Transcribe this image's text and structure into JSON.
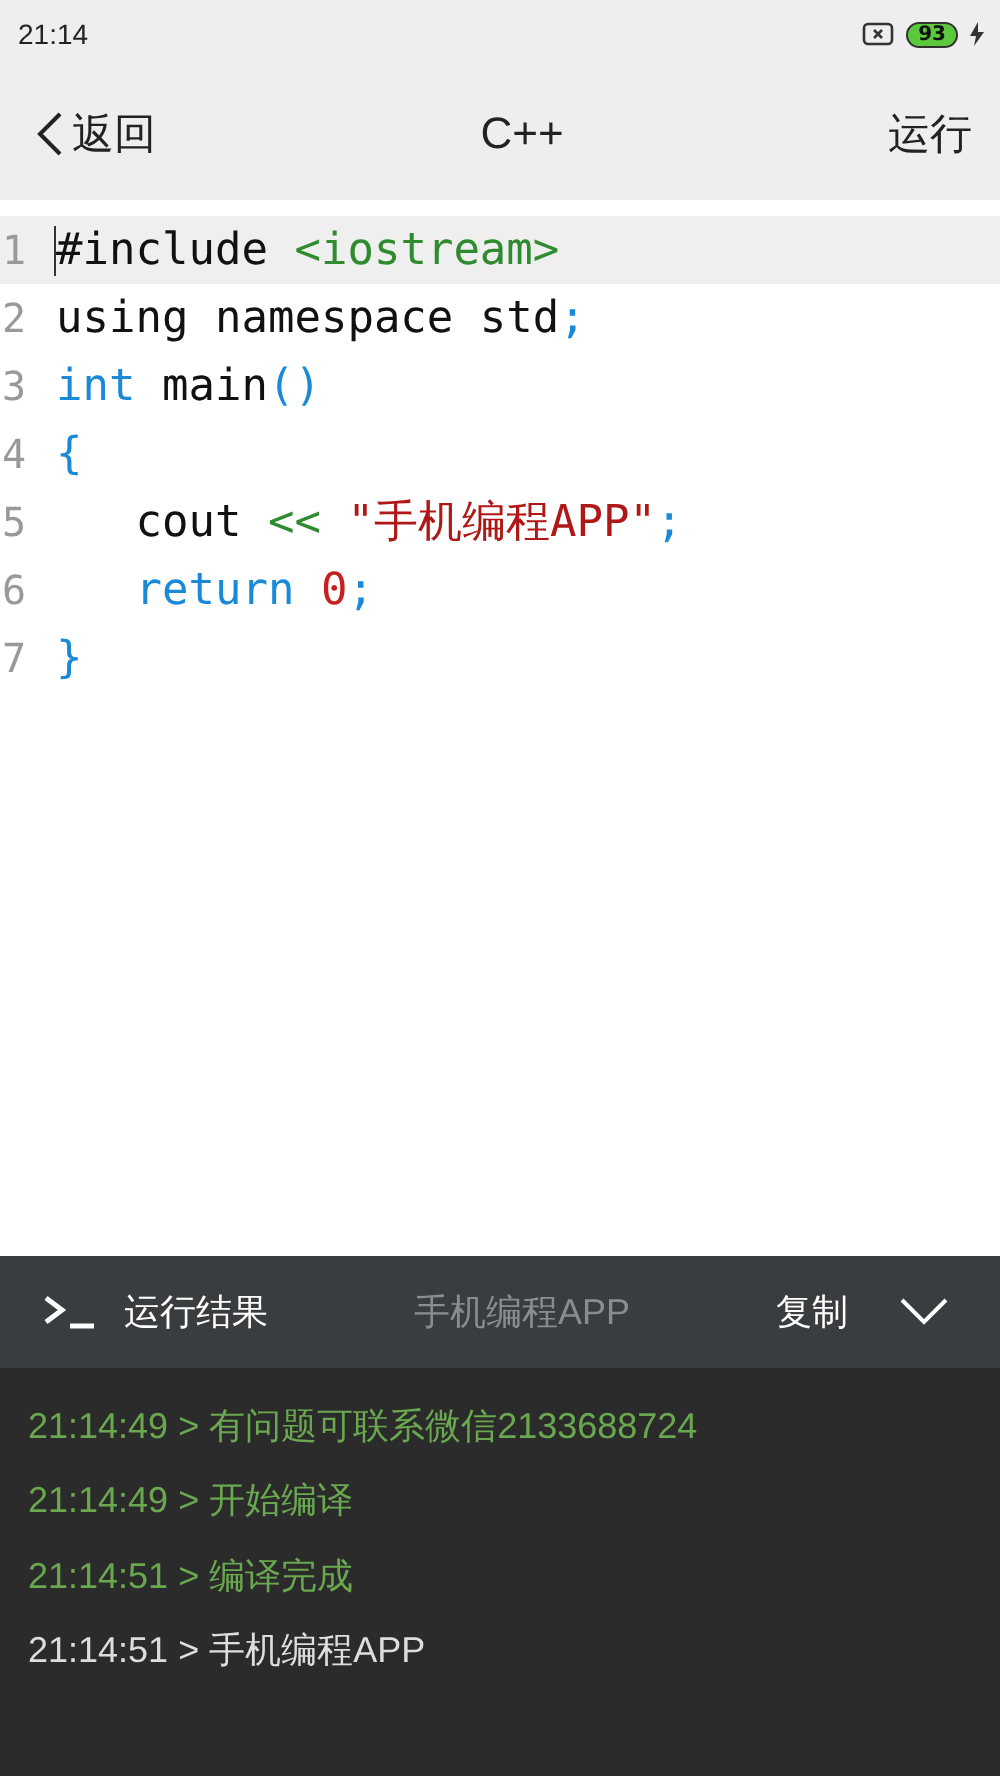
{
  "status_bar": {
    "time": "21:14",
    "battery": "93"
  },
  "header": {
    "back": "返回",
    "title": "C++",
    "action": "运行"
  },
  "code": [
    {
      "number": "1",
      "current": true,
      "tokens": [
        {
          "text": "#include ",
          "kind": "plain"
        },
        {
          "text": "<iostream>",
          "kind": "operator"
        }
      ]
    },
    {
      "number": "2",
      "current": false,
      "tokens": [
        {
          "text": "using namespace std",
          "kind": "plain"
        },
        {
          "text": ";",
          "kind": "punct"
        }
      ]
    },
    {
      "number": "3",
      "current": false,
      "tokens": [
        {
          "text": "int",
          "kind": "keyword"
        },
        {
          "text": " main",
          "kind": "plain"
        },
        {
          "text": "()",
          "kind": "punct"
        }
      ]
    },
    {
      "number": "4",
      "current": false,
      "tokens": [
        {
          "text": "{",
          "kind": "punct"
        }
      ]
    },
    {
      "number": "5",
      "current": false,
      "tokens": [
        {
          "text": "   cout ",
          "kind": "plain"
        },
        {
          "text": "<<",
          "kind": "operator"
        },
        {
          "text": " \"手机编程APP\"",
          "kind": "string"
        },
        {
          "text": ";",
          "kind": "punct"
        }
      ]
    },
    {
      "number": "6",
      "current": false,
      "tokens": [
        {
          "text": "   return",
          "kind": "keyword"
        },
        {
          "text": " 0",
          "kind": "number"
        },
        {
          "text": ";",
          "kind": "punct"
        }
      ]
    },
    {
      "number": "7",
      "current": false,
      "tokens": [
        {
          "text": "}",
          "kind": "punct"
        }
      ]
    }
  ],
  "console": {
    "title": "运行结果",
    "program": "手机编程APP",
    "copy": "复制",
    "expanded": true,
    "lines": [
      {
        "text": "21:14:49 > 有问题可联系微信2133688724",
        "kind": "info"
      },
      {
        "text": "21:14:49 > 开始编译",
        "kind": "info"
      },
      {
        "text": "21:14:51 > 编译完成",
        "kind": "info"
      },
      {
        "text": "21:14:51 > 手机编程APP",
        "kind": "output"
      }
    ]
  }
}
